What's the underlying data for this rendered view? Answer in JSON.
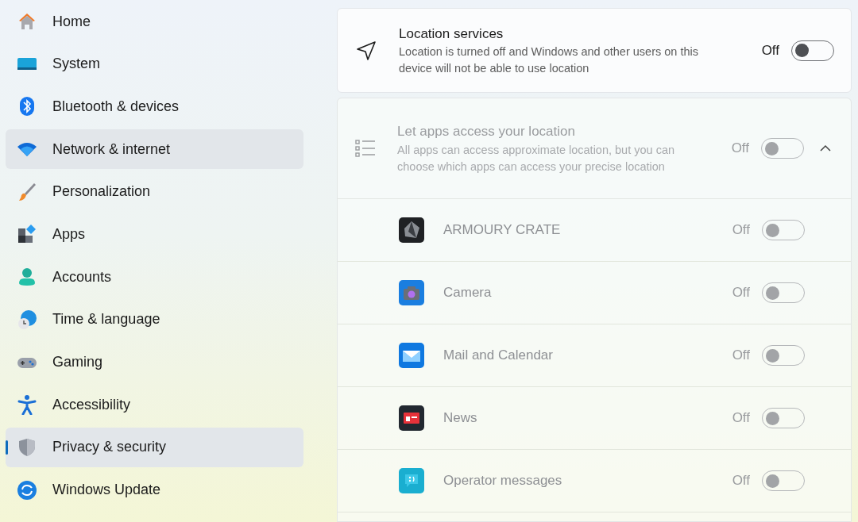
{
  "sidebar": {
    "items": [
      {
        "label": "Home",
        "kind": "home",
        "selected": false,
        "highlighted": false
      },
      {
        "label": "System",
        "kind": "system",
        "selected": false,
        "highlighted": false
      },
      {
        "label": "Bluetooth & devices",
        "kind": "bluetooth",
        "selected": false,
        "highlighted": false
      },
      {
        "label": "Network & internet",
        "kind": "network",
        "selected": false,
        "highlighted": true
      },
      {
        "label": "Personalization",
        "kind": "brush",
        "selected": false,
        "highlighted": false
      },
      {
        "label": "Apps",
        "kind": "apps",
        "selected": false,
        "highlighted": false
      },
      {
        "label": "Accounts",
        "kind": "accounts",
        "selected": false,
        "highlighted": false
      },
      {
        "label": "Time & language",
        "kind": "time",
        "selected": false,
        "highlighted": false
      },
      {
        "label": "Gaming",
        "kind": "gaming",
        "selected": false,
        "highlighted": false
      },
      {
        "label": "Accessibility",
        "kind": "accessibility",
        "selected": false,
        "highlighted": false
      },
      {
        "label": "Privacy & security",
        "kind": "privacy",
        "selected": true,
        "highlighted": true
      },
      {
        "label": "Windows Update",
        "kind": "update",
        "selected": false,
        "highlighted": false
      }
    ]
  },
  "location_services": {
    "title": "Location services",
    "description": "Location is turned off and Windows and other users on this device will not be able to use location",
    "state_label": "Off",
    "on": false
  },
  "app_access": {
    "title": "Let apps access your location",
    "description": "All apps can access approximate location, but you can choose which apps can access your precise location",
    "state_label": "Off",
    "on": false,
    "disabled": true,
    "expanded": true,
    "apps": [
      {
        "name": "ARMOURY CRATE",
        "kind": "armoury",
        "state_label": "Off",
        "on": false
      },
      {
        "name": "Camera",
        "kind": "camera",
        "state_label": "Off",
        "on": false
      },
      {
        "name": "Mail and Calendar",
        "kind": "mail",
        "state_label": "Off",
        "on": false
      },
      {
        "name": "News",
        "kind": "news",
        "state_label": "Off",
        "on": false
      },
      {
        "name": "Operator messages",
        "kind": "operator",
        "state_label": "Off",
        "on": false
      }
    ]
  }
}
